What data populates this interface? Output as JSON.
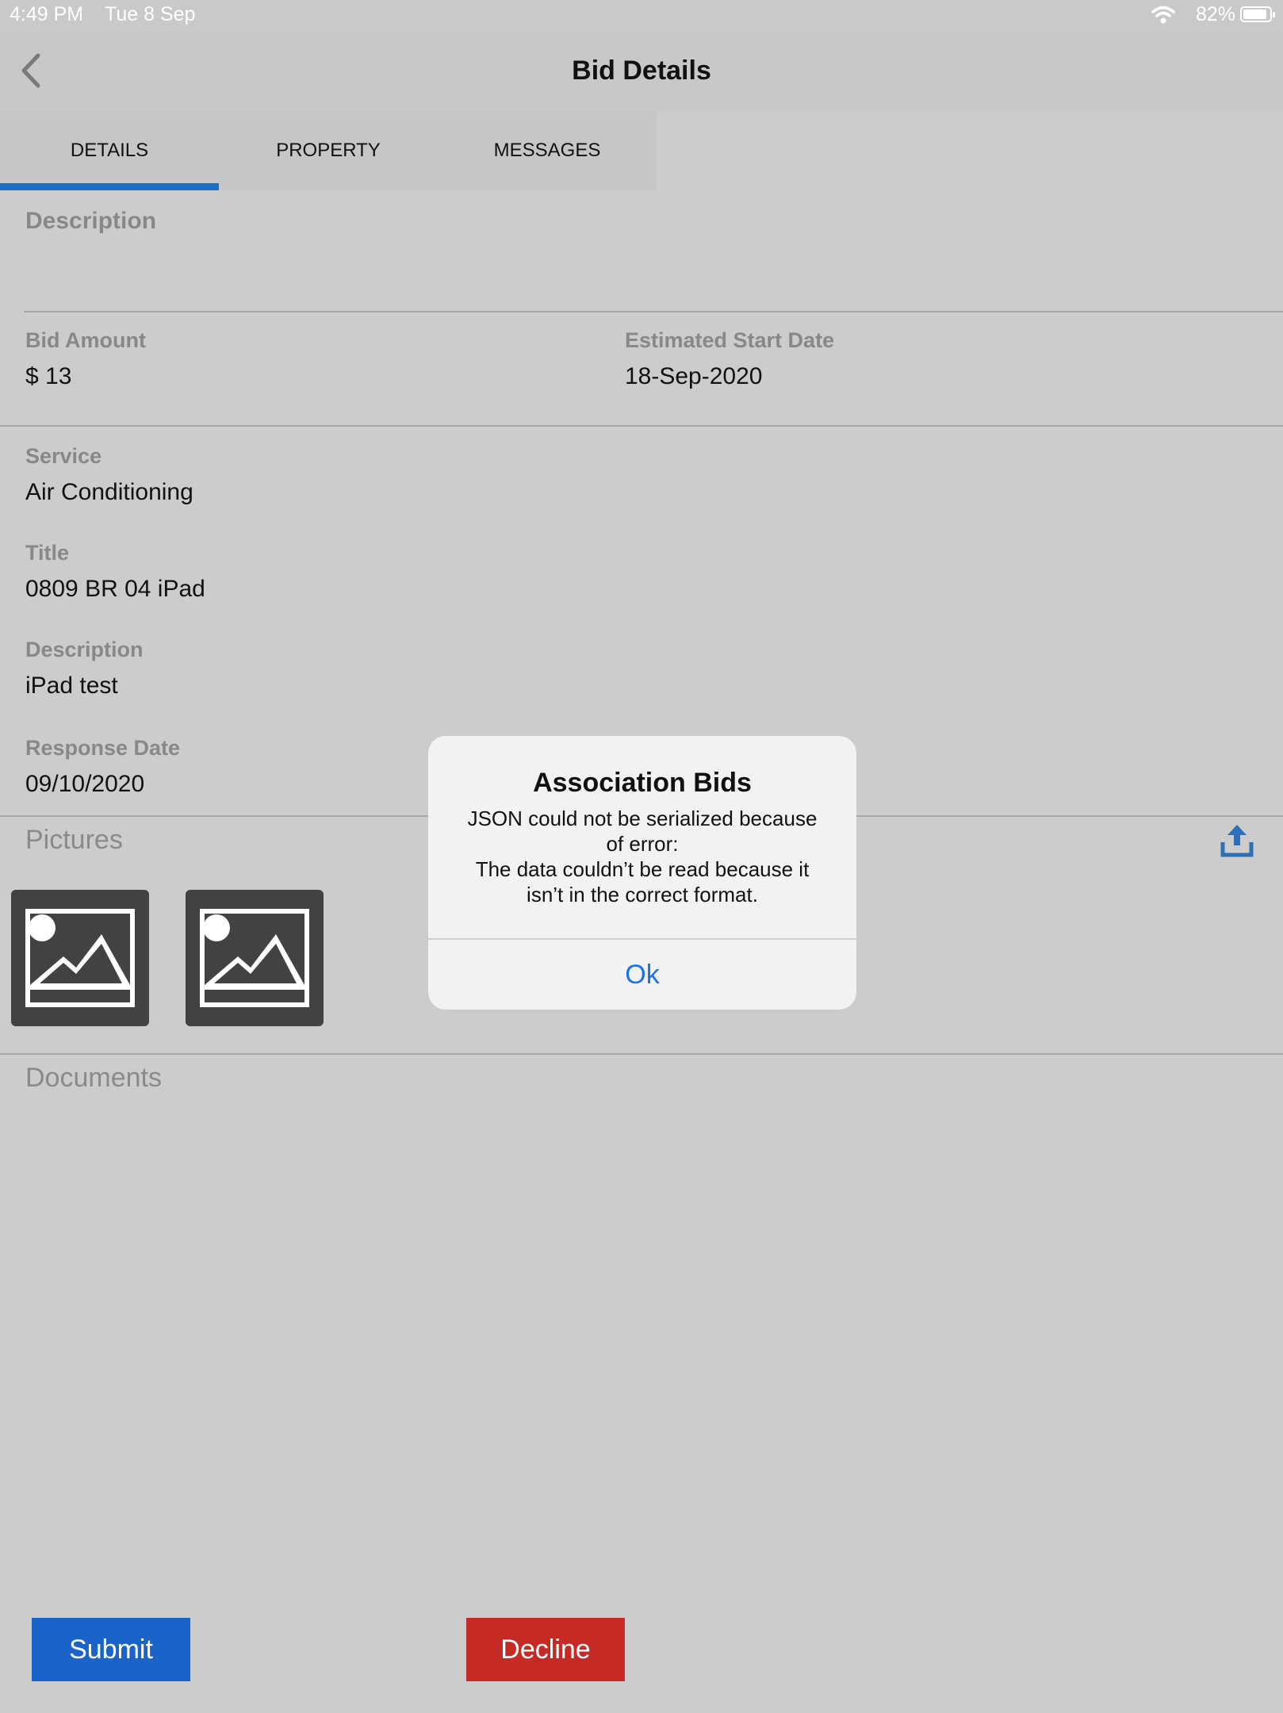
{
  "status_bar": {
    "time": "4:49 PM",
    "date": "Tue 8 Sep",
    "battery": "82%"
  },
  "nav": {
    "title": "Bid Details"
  },
  "tabs": [
    {
      "label": "DETAILS",
      "active": true
    },
    {
      "label": "PROPERTY",
      "active": false
    },
    {
      "label": "MESSAGES",
      "active": false
    }
  ],
  "details": {
    "description_label": "Description",
    "bid_amount_label": "Bid Amount",
    "bid_amount_value": "$ 13",
    "start_date_label": "Estimated Start Date",
    "start_date_value": "18-Sep-2020",
    "service_label": "Service",
    "service_value": "Air Conditioning",
    "title_label": "Title",
    "title_value": "0809 BR 04 iPad",
    "description2_label": "Description",
    "description2_value": "iPad test",
    "response_date_label": "Response Date",
    "response_date_value": "09/10/2020"
  },
  "pictures": {
    "title": "Pictures",
    "count": 2,
    "upload_icon": "upload-icon"
  },
  "documents": {
    "title": "Documents"
  },
  "buttons": {
    "submit": "Submit",
    "decline": "Decline"
  },
  "alert": {
    "title": "Association Bids",
    "message_line1": "JSON could not be serialized because",
    "message_line2": "of error:",
    "message_line3": "The data couldn’t be read because it",
    "message_line4": "isn’t in the correct format.",
    "ok": "Ok"
  },
  "colors": {
    "accent": "#1e6ec8",
    "submit": "#1a63c8",
    "decline": "#c62a25",
    "link": "#1a73e8"
  }
}
